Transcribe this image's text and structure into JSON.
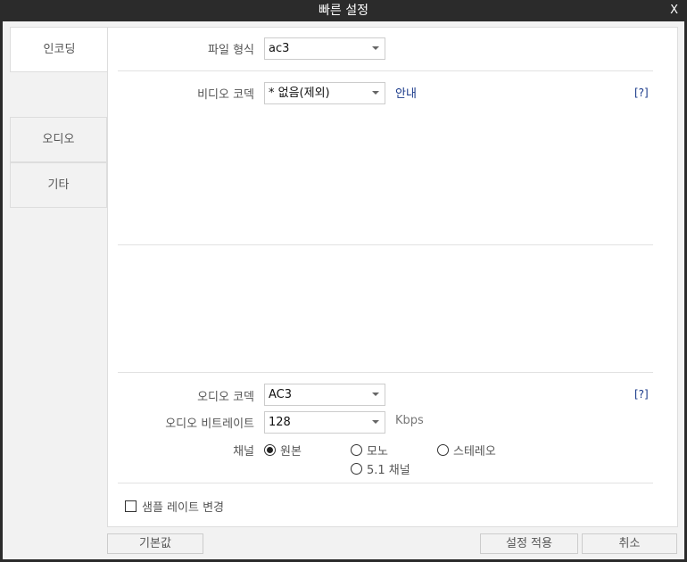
{
  "title": "빠른 설정",
  "close": "X",
  "tabs": [
    "인코딩",
    "오디오",
    "기타"
  ],
  "file_format": {
    "label": "파일 형식",
    "value": "ac3"
  },
  "video_codec": {
    "label": "비디오 코덱",
    "value": "* 없음(제외)",
    "guide": "안내",
    "help": "[?]"
  },
  "audio_codec": {
    "label": "오디오 코덱",
    "value": "AC3",
    "help": "[?]"
  },
  "audio_bitrate": {
    "label": "오디오 비트레이트",
    "value": "128",
    "unit": "Kbps"
  },
  "channel": {
    "label": "채널",
    "options": [
      "원본",
      "모노",
      "스테레오",
      "5.1 채널"
    ],
    "selected": "원본"
  },
  "sample_rate": {
    "label": "샘플 레이트 변경",
    "checked": false
  },
  "buttons": {
    "default": "기본값",
    "apply": "설정 적용",
    "cancel": "취소"
  }
}
